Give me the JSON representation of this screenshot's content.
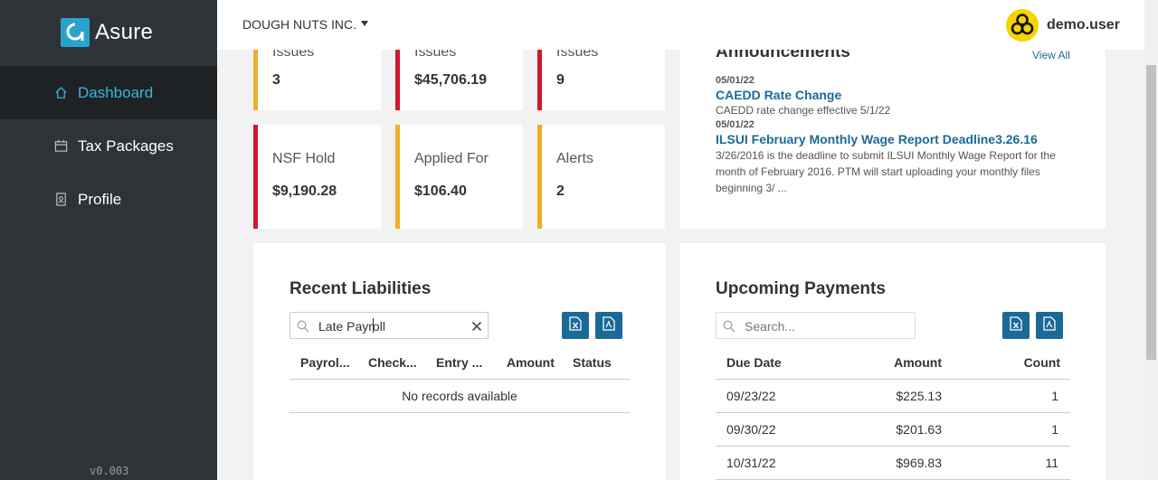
{
  "app": {
    "logo_text": "Asure",
    "version": "v0.003"
  },
  "sidebar": {
    "items": [
      {
        "label": "Dashboard",
        "icon": "home-icon"
      },
      {
        "label": "Tax Packages",
        "icon": "calendar-icon"
      },
      {
        "label": "Profile",
        "icon": "id-badge-icon"
      }
    ]
  },
  "header": {
    "company": "DOUGH NUTS INC.",
    "username": "demo.user",
    "avatar_icon": "biohazard-icon"
  },
  "stats": {
    "top": [
      {
        "label": "Issues",
        "value": "3"
      },
      {
        "label": "Issues",
        "value": "$45,706.19"
      },
      {
        "label": "Issues",
        "value": "9"
      }
    ],
    "bottom": [
      {
        "label": "NSF Hold",
        "value": "$9,190.28"
      },
      {
        "label": "Applied For",
        "value": "$106.40"
      },
      {
        "label": "Alerts",
        "value": "2"
      }
    ]
  },
  "announcements": {
    "title": "Announcements",
    "view_all": "View All",
    "items": [
      {
        "date": "05/01/22",
        "title": "CAEDD Rate Change",
        "desc": "CAEDD rate change effective 5/1/22"
      },
      {
        "date": "05/01/22",
        "title": "ILSUI February Monthly Wage Report Deadline3.26.16",
        "desc_lines": [
          "3/26/2016 is the deadline to submit ILSUI Monthly Wage Report for the",
          "month of February 2016. PTM will start uploading your monthly files",
          "beginning 3/ ..."
        ]
      }
    ]
  },
  "recent_liabilities": {
    "title": "Recent Liabilities",
    "search_value": "Late Payroll",
    "columns": [
      "Payrol...",
      "Check...",
      "Entry ...",
      "Amount",
      "Status"
    ],
    "empty_text": "No records available"
  },
  "upcoming_payments": {
    "title": "Upcoming Payments",
    "search_placeholder": "Search...",
    "columns": [
      "Due Date",
      "Amount",
      "Count"
    ],
    "rows": [
      [
        "09/23/22",
        "$225.13",
        "1"
      ],
      [
        "09/30/22",
        "$201.63",
        "1"
      ],
      [
        "10/31/22",
        "$969.83",
        "11"
      ]
    ]
  },
  "colors": {
    "accent": "#1b6a96",
    "sidebar_bg": "#2e3338",
    "sidebar_active": "#32b8db",
    "status_red": "#d7152a",
    "status_orange": "#f0ad27"
  }
}
